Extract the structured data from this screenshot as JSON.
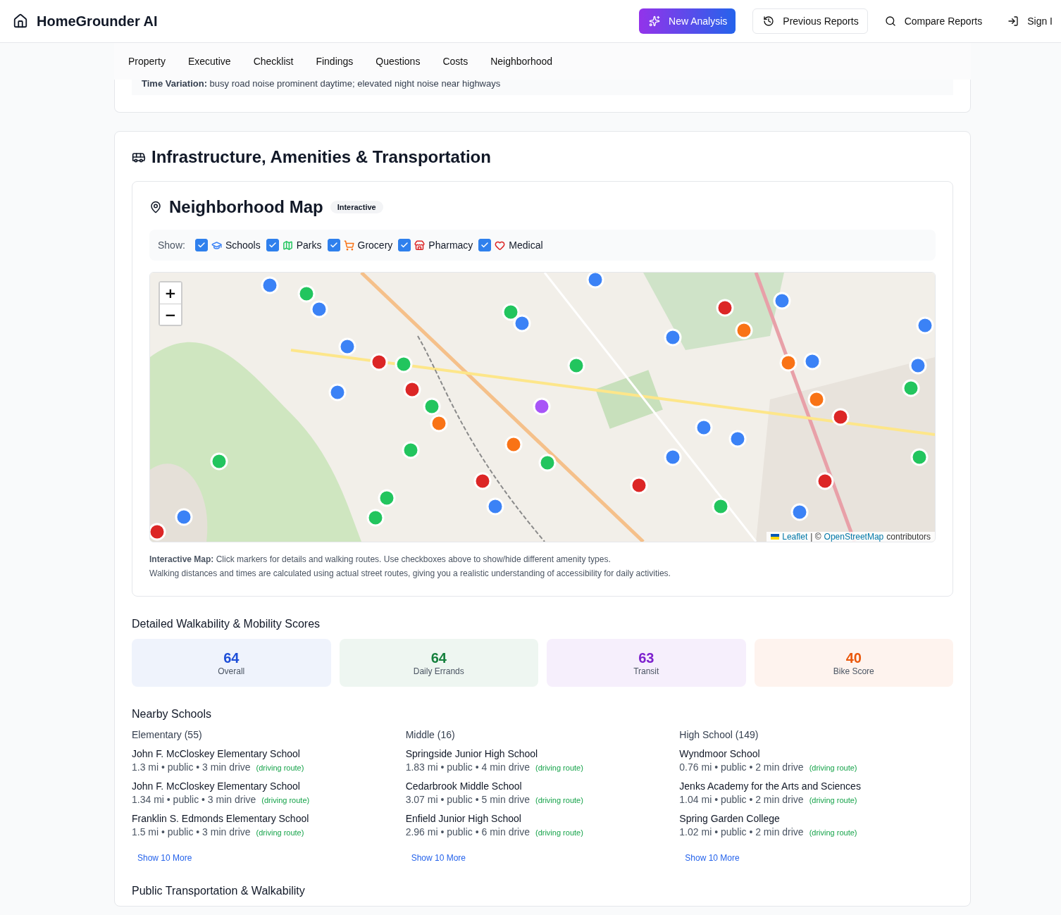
{
  "header": {
    "brand": "HomeGrounder AI",
    "actions": [
      {
        "kind": "primary",
        "label": "New Analysis"
      },
      {
        "kind": "outline",
        "label": "Previous Reports"
      },
      {
        "kind": "plain",
        "label": "Compare Reports"
      },
      {
        "kind": "plain",
        "label": "Sign I"
      }
    ]
  },
  "tabs": [
    "Property",
    "Executive",
    "Checklist",
    "Findings",
    "Questions",
    "Costs",
    "Neighborhood"
  ],
  "previous_card": {
    "label": "Time Variation:",
    "text": "busy road noise prominent daytime; elevated night noise near highways"
  },
  "section": {
    "title": "Infrastructure, Amenities & Transportation",
    "map": {
      "title": "Neighborhood Map",
      "badge": "Interactive",
      "show_label": "Show:",
      "filters": [
        {
          "kind": "school",
          "label": "Schools",
          "checked": true,
          "color": "#3b82f6"
        },
        {
          "kind": "park",
          "label": "Parks",
          "checked": true,
          "color": "#22c55e"
        },
        {
          "kind": "grocery",
          "label": "Grocery",
          "checked": true,
          "color": "#f97316"
        },
        {
          "kind": "pharmacy",
          "label": "Pharmacy",
          "checked": true,
          "color": "#dc2626"
        },
        {
          "kind": "medical",
          "label": "Medical",
          "checked": true,
          "color": "#dc2626"
        }
      ],
      "zoom_in": "+",
      "zoom_out": "−",
      "attribution": {
        "leaflet": "Leaflet",
        "separator": "| ©",
        "osm": "OpenStreetMap",
        "suffix": "contributors"
      },
      "notes": [
        "**Interactive Map:** Click markers for details and walking routes. Use checkboxes above to show/hide different amenity types.",
        "Walking distances and times are calculated using actual street routes, giving you a realistic understanding of accessibility for daily activities."
      ]
    },
    "scores_title": "Detailed Walkability & Mobility Scores",
    "scores": [
      {
        "value": "64",
        "label": "Overall",
        "color": "#1d4ed8"
      },
      {
        "value": "64",
        "label": "Daily Errands",
        "color": "#15803d"
      },
      {
        "value": "63",
        "label": "Transit",
        "color": "#7e22ce"
      },
      {
        "value": "40",
        "label": "Bike Score",
        "color": "#ea580c"
      }
    ],
    "schools_title": "Nearby Schools",
    "school_groups": [
      {
        "title": "Elementary (55)",
        "more": "Show 10 More",
        "schools": [
          {
            "name": "John F. McCloskey Elementary School",
            "details": "1.3 mi • public • 3 min drive",
            "route": "(driving route)"
          },
          {
            "name": "John F. McCloskey Elementary School",
            "details": "1.34 mi • public • 3 min drive",
            "route": "(driving route)"
          },
          {
            "name": "Franklin S. Edmonds Elementary School",
            "details": "1.5 mi • public • 3 min drive",
            "route": "(driving route)"
          }
        ]
      },
      {
        "title": "Middle (16)",
        "more": "Show 10 More",
        "schools": [
          {
            "name": "Springside Junior High School",
            "details": "1.83 mi • public • 4 min drive",
            "route": "(driving route)"
          },
          {
            "name": "Cedarbrook Middle School",
            "details": "3.07 mi • public • 5 min drive",
            "route": "(driving route)"
          },
          {
            "name": "Enfield Junior High School",
            "details": "2.96 mi • public • 6 min drive",
            "route": "(driving route)"
          }
        ]
      },
      {
        "title": "High School (149)",
        "more": "Show 10 More",
        "schools": [
          {
            "name": "Wyndmoor School",
            "details": "0.76 mi • public • 2 min drive",
            "route": "(driving route)"
          },
          {
            "name": "Jenks Academy for the Arts and Sciences",
            "details": "1.04 mi • public • 2 min drive",
            "route": "(driving route)"
          },
          {
            "name": "Spring Garden College",
            "details": "1.02 mi • public • 2 min drive",
            "route": "(driving route)"
          }
        ]
      }
    ],
    "transport_title": "Public Transportation & Walkability"
  }
}
